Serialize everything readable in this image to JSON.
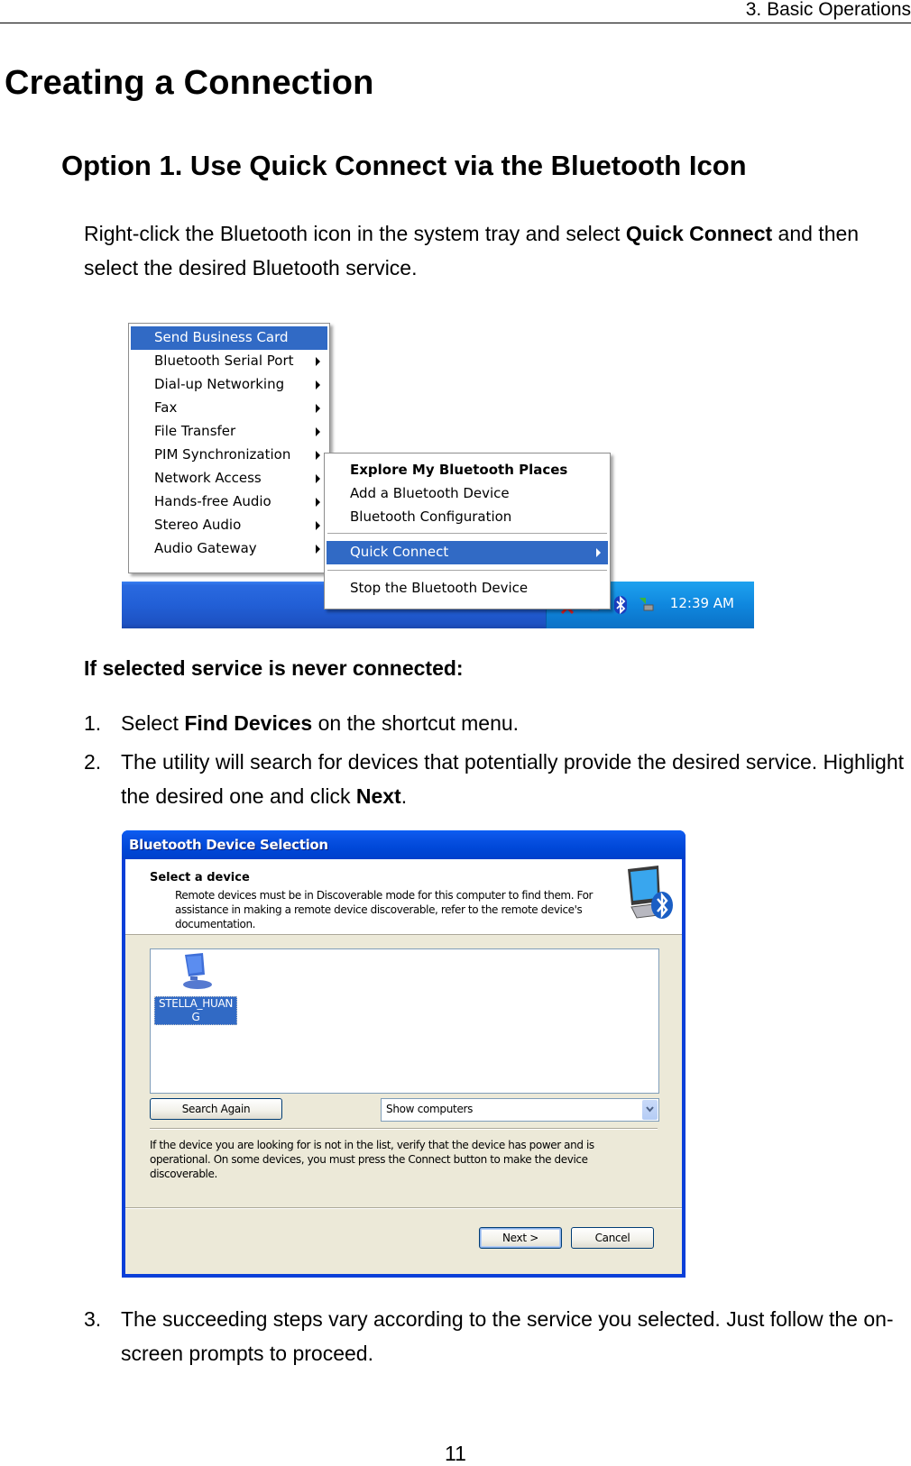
{
  "running_head": "3. Basic Operations",
  "section_title": "Creating a Connection",
  "option_title": "Option 1. Use Quick Connect via the Bluetooth Icon",
  "intro": {
    "part1": "Right-click the Bluetooth icon in the system tray and select ",
    "bold": "Quick Connect",
    "part2": " and then select the desired Bluetooth service."
  },
  "screenshot_menu": {
    "service_menu": {
      "items": [
        {
          "label": "Send Business Card",
          "submenu": false,
          "selected": true
        },
        {
          "label": "Bluetooth Serial Port",
          "submenu": true
        },
        {
          "label": "Dial-up Networking",
          "submenu": true
        },
        {
          "label": "Fax",
          "submenu": true
        },
        {
          "label": "File Transfer",
          "submenu": true
        },
        {
          "label": "PIM Synchronization",
          "submenu": true
        },
        {
          "label": "Network Access",
          "submenu": true
        },
        {
          "label": "Hands-free Audio",
          "submenu": true
        },
        {
          "label": "Stereo Audio",
          "submenu": true
        },
        {
          "label": "Audio Gateway",
          "submenu": true
        }
      ]
    },
    "tray_menu": {
      "items": [
        {
          "label": "Explore My Bluetooth Places",
          "bold": true
        },
        {
          "label": "Add a Bluetooth Device"
        },
        {
          "label": "Bluetooth Configuration"
        },
        {
          "label": "Quick Connect",
          "submenu": true,
          "selected": true
        },
        {
          "label": "Stop the Bluetooth Device"
        }
      ]
    },
    "taskbar": {
      "clock": "12:39 AM",
      "tray_icons": [
        "network-disconnected-icon",
        "network-icon",
        "bluetooth-icon",
        "safely-remove-hardware-icon"
      ]
    },
    "colors": {
      "highlight": "#316ac5",
      "taskbar": "#225fd6",
      "tray": "#0f87de"
    }
  },
  "subheading": "If selected service is never connected:",
  "steps": [
    {
      "num": "1.",
      "part1": "Select ",
      "bold": "Find Devices",
      "part2": " on the shortcut menu."
    },
    {
      "num": "2.",
      "part1": "The utility will search for devices that potentially provide the desired service. Highlight the desired one and click ",
      "bold": "Next",
      "part2": "."
    },
    {
      "num": "3.",
      "part1": "The succeeding steps vary according to the service you selected. Just follow the on-screen prompts to proceed.",
      "bold": "",
      "part2": ""
    }
  ],
  "screenshot_dialog": {
    "title": "Bluetooth Device Selection",
    "header_title": "Select a device",
    "header_desc": "Remote devices must be in Discoverable mode for this computer to find them. For assistance in making a remote device discoverable, refer to the remote device's documentation.",
    "devices": [
      {
        "name": "STELLA_HUANG",
        "selected": true
      }
    ],
    "search_again_label": "Search Again",
    "filter_value": "Show computers",
    "info_text": "If the device you are looking for is not in the list, verify that the device has power and is operational. On some devices, you must press the Connect button to make the device discoverable.",
    "next_label": "Next >",
    "cancel_label": "Cancel",
    "colors": {
      "titlebar": "#0048d8",
      "body": "#ece9d8",
      "selection": "#316ac5"
    }
  },
  "page_number": "11"
}
